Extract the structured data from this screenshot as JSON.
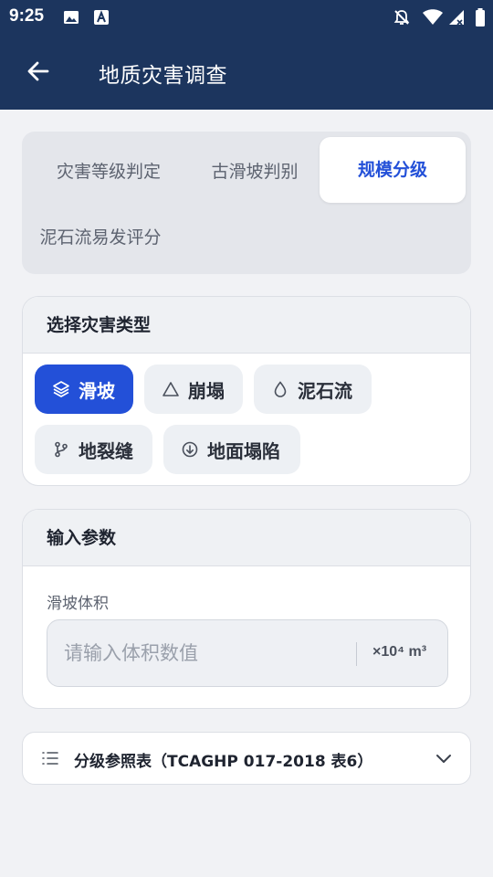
{
  "status_bar": {
    "time": "9:25",
    "icons": [
      "image-icon",
      "a-icon",
      "notifications-off-icon",
      "wifi-icon",
      "signal-icon",
      "battery-icon"
    ]
  },
  "app_bar": {
    "title": "地质灾害调查",
    "back_icon": "arrow-left-icon"
  },
  "tabs": {
    "items": [
      {
        "label": "灾害等级判定",
        "active": false
      },
      {
        "label": "古滑坡判别",
        "active": false
      },
      {
        "label": "规模分级",
        "active": true
      },
      {
        "label": "泥石流易发评分",
        "active": false
      }
    ]
  },
  "hazard_type": {
    "heading": "选择灾害类型",
    "options": [
      {
        "label": "滑坡",
        "icon": "layers-icon",
        "selected": true
      },
      {
        "label": "崩塌",
        "icon": "triangle-icon",
        "selected": false
      },
      {
        "label": "泥石流",
        "icon": "drop-icon",
        "selected": false
      },
      {
        "label": "地裂缝",
        "icon": "branch-icon",
        "selected": false
      },
      {
        "label": "地面塌陷",
        "icon": "circle-arrow-down-icon",
        "selected": false
      }
    ]
  },
  "params": {
    "heading": "输入参数",
    "field_label": "滑坡体积",
    "placeholder": "请输入体积数值",
    "value": "",
    "unit": "×10⁴ m³"
  },
  "reference": {
    "label": "分级参照表（TCAGHP 017-2018 表6）",
    "icon": "list-icon",
    "expand_icon": "chevron-down-icon"
  },
  "colors": {
    "header_bg": "#1c355e",
    "accent": "#2350d8",
    "page_bg": "#f1f2f5"
  }
}
